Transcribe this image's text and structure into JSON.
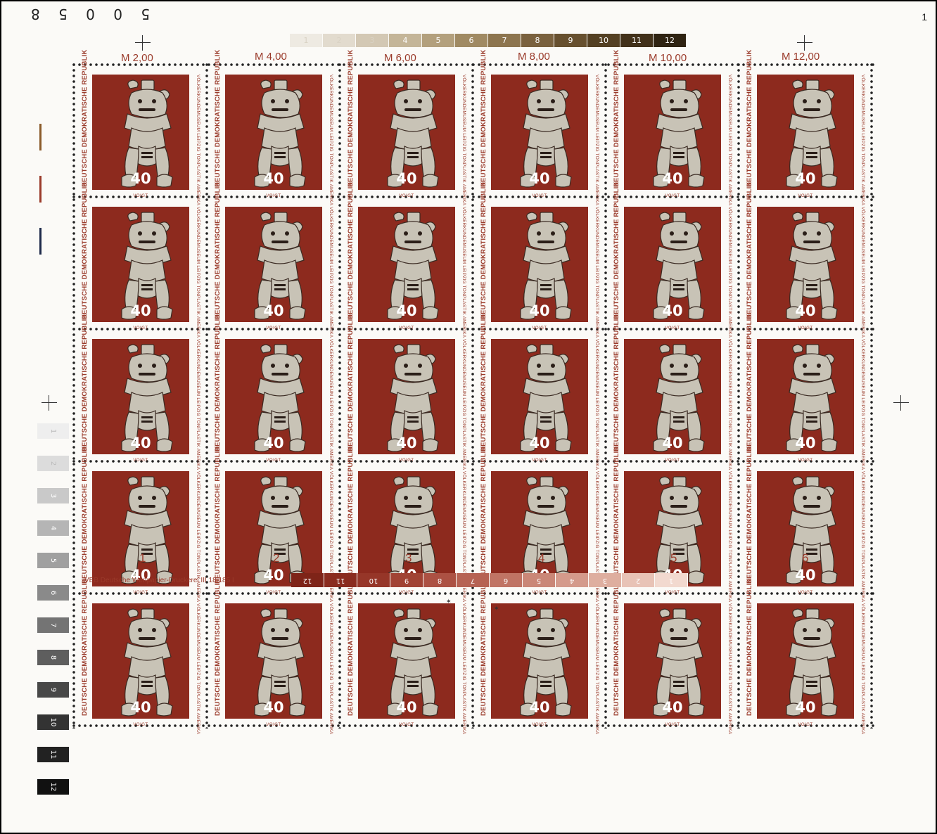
{
  "sheet": {
    "serial_number": "5 0 0 5 8",
    "corner_mark": "1",
    "printer_imprint": "VEB Deutsche Wertpapier-Druckerei   III 18 185   I"
  },
  "color_bar_top": {
    "cells": [
      "1",
      "2",
      "3",
      "4",
      "5",
      "6",
      "7",
      "8",
      "9",
      "10",
      "11",
      "12"
    ],
    "colors": [
      "#eeeae2",
      "#e2dbce",
      "#d3c8b4",
      "#c4b598",
      "#b3a07d",
      "#a08a63",
      "#8d754f",
      "#7a613e",
      "#67502f",
      "#544023",
      "#42311a",
      "#2f2312"
    ]
  },
  "value_labels": [
    "M 2,00",
    "M 4,00",
    "M 6,00",
    "M 8,00",
    "M 10,00",
    "M 12,00"
  ],
  "stamp": {
    "country": "DEUTSCHE DEMOKRATISCHE REPUBLIK",
    "subject": "VÖLKERKUNDEMUSEUM LEIPZIG      TONPLASTIK AMERIKA",
    "denomination": "40",
    "designer": "VOIGT",
    "background_color": "#8d2a1e",
    "figure_color": "#c8c3b6",
    "figure_icon": "clay-figure-icon"
  },
  "grid": {
    "rows": 5,
    "columns": 6
  },
  "column_numbers": [
    "1",
    "2",
    "3",
    "4",
    "5",
    "6"
  ],
  "color_bar_bottom": {
    "cells": [
      "12",
      "11",
      "10",
      "9",
      "8",
      "7",
      "6",
      "5",
      "4",
      "3",
      "2",
      "1"
    ],
    "colors": [
      "#7e2418",
      "#8a2c1f",
      "#963628",
      "#a14334",
      "#ac5143",
      "#b66253",
      "#c07464",
      "#ca8777",
      "#d49a8b",
      "#deae9f",
      "#e8c3b6",
      "#f2d9cf"
    ]
  },
  "color_bar_left": {
    "cells": [
      "1",
      "2",
      "3",
      "4",
      "5",
      "6",
      "7",
      "8",
      "9",
      "10",
      "11",
      "12"
    ],
    "colors": [
      "#eeeeee",
      "#dcdcdc",
      "#c9c9c9",
      "#b5b5b5",
      "#a0a0a0",
      "#8a8a8a",
      "#747474",
      "#5e5e5e",
      "#484848",
      "#333333",
      "#222222",
      "#111111"
    ]
  },
  "side_marks": {
    "colors": [
      "#8a5a2a",
      "#9a3a2a",
      "#1e2a4a"
    ]
  }
}
